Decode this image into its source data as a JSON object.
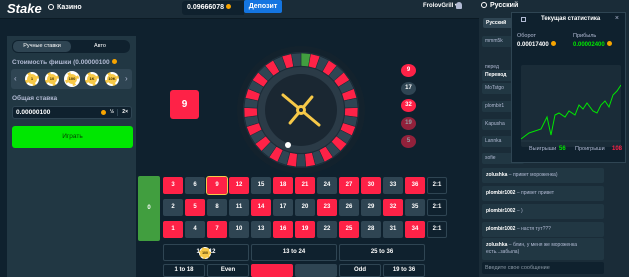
{
  "header": {
    "logo": "Stake",
    "casino": "Казино",
    "balance": "0.09666078",
    "deposit": "Депозит",
    "username": "FrolovGrill",
    "language": "Русский"
  },
  "bet_panel": {
    "tab_manual": "Ручные ставки",
    "tab_auto": "Авто",
    "chip_label": "Стоимость фишки (0.00000100",
    "chips": [
      "1",
      "10",
      "100",
      "1K",
      "10K"
    ],
    "selected_chip_index": 2,
    "total_bet_label": "Общая ставка",
    "total_bet_value": "0.00000100",
    "half": "½",
    "double": "2×",
    "play_button": "Играть"
  },
  "game": {
    "last_result": "9",
    "history": [
      {
        "value": "9",
        "color": "#fe2247"
      },
      {
        "value": "17",
        "color": "#2f4553"
      },
      {
        "value": "32",
        "color": "#fe2247"
      },
      {
        "value": "19",
        "color": "#fe2247"
      },
      {
        "value": "5",
        "color": "#fe2247"
      }
    ],
    "placed_chip": "100"
  },
  "table": {
    "zero": "0",
    "rows": [
      [
        {
          "n": "3",
          "c": "r"
        },
        {
          "n": "6",
          "c": "b"
        },
        {
          "n": "9",
          "c": "r",
          "sel": true
        },
        {
          "n": "12",
          "c": "r"
        },
        {
          "n": "15",
          "c": "b"
        },
        {
          "n": "18",
          "c": "r"
        },
        {
          "n": "21",
          "c": "r"
        },
        {
          "n": "24",
          "c": "b"
        },
        {
          "n": "27",
          "c": "r"
        },
        {
          "n": "30",
          "c": "r"
        },
        {
          "n": "33",
          "c": "b"
        },
        {
          "n": "36",
          "c": "r"
        },
        {
          "n": "2:1",
          "c": "o"
        }
      ],
      [
        {
          "n": "2",
          "c": "b"
        },
        {
          "n": "5",
          "c": "r"
        },
        {
          "n": "8",
          "c": "b"
        },
        {
          "n": "11",
          "c": "b"
        },
        {
          "n": "14",
          "c": "r"
        },
        {
          "n": "17",
          "c": "b"
        },
        {
          "n": "20",
          "c": "b"
        },
        {
          "n": "23",
          "c": "r"
        },
        {
          "n": "26",
          "c": "b"
        },
        {
          "n": "29",
          "c": "b"
        },
        {
          "n": "32",
          "c": "r"
        },
        {
          "n": "35",
          "c": "b"
        },
        {
          "n": "2:1",
          "c": "o"
        }
      ],
      [
        {
          "n": "1",
          "c": "r"
        },
        {
          "n": "4",
          "c": "b"
        },
        {
          "n": "7",
          "c": "r"
        },
        {
          "n": "10",
          "c": "b"
        },
        {
          "n": "13",
          "c": "b"
        },
        {
          "n": "16",
          "c": "r"
        },
        {
          "n": "19",
          "c": "r"
        },
        {
          "n": "22",
          "c": "b"
        },
        {
          "n": "25",
          "c": "r"
        },
        {
          "n": "28",
          "c": "b"
        },
        {
          "n": "31",
          "c": "b"
        },
        {
          "n": "34",
          "c": "r"
        },
        {
          "n": "2:1",
          "c": "o"
        }
      ]
    ],
    "dozens": [
      "1 to 12",
      "13 to 24",
      "25 to 36"
    ],
    "bottom": [
      "1 to 18",
      "Even",
      "",
      "",
      "Odd",
      "19 to 36"
    ]
  },
  "stats": {
    "title": "Текущая статистика",
    "turnover_label": "Оборот",
    "turnover_value": "0.00017400",
    "profit_label": "Прибыль",
    "profit_value": "0.00002400",
    "wins_label": "Выигрыши",
    "wins_value": "56",
    "losses_label": "Проигрыши",
    "losses_value": "108",
    "profit_color": "#00e701",
    "losses_color": "#fe2247"
  },
  "chat": {
    "lang": "Русский",
    "side_rows": [
      "mmm5k",
      "",
      "перед",
      "Перевод",
      "MoTstgo",
      "plombir1",
      "Kapusha",
      "Lannka",
      "sofie"
    ],
    "messages": [
      {
        "user": "zolushka",
        "text": " – привет мороженка)"
      },
      {
        "user": "plombir1002",
        "text": " – привет привет"
      },
      {
        "user": "plombir1002",
        "text": " – )"
      },
      {
        "user": "plombir1002",
        "text": " – настя тут???"
      },
      {
        "user": "zolushka",
        "text": " – блин, у меня же мороженка есть...забыла)"
      }
    ],
    "input_placeholder": "Введите свое сообщение"
  }
}
